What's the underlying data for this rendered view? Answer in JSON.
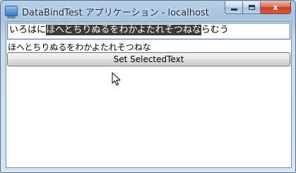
{
  "window": {
    "title": "DataBindTest アプリケーション - localhost",
    "app_icon": "app-window-icon",
    "caption_buttons": {
      "minimize": "minimize-icon",
      "maximize": "maximize-icon",
      "close_label": "x"
    }
  },
  "textbox": {
    "before": "いろはに",
    "selected": "ほへとちりぬるをわかよたれそつねな",
    "after": "らむう"
  },
  "selected_text_display": "ほへとちりぬるをわかよたれそつねな",
  "button": {
    "label": "Set SelectedText"
  },
  "colors": {
    "selection_background": "#3a3a3a",
    "selection_text": "#ffffff",
    "chrome": "#b9d1ea"
  }
}
